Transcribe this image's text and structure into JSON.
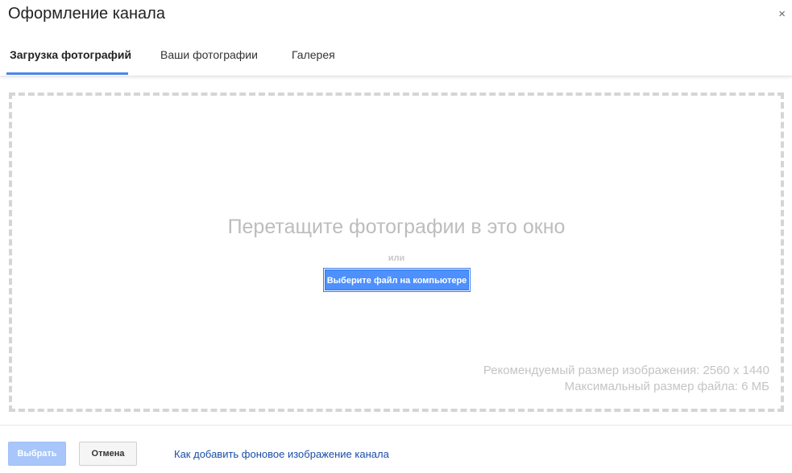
{
  "dialog": {
    "title": "Оформление канала",
    "close_label": "×"
  },
  "tabs": [
    {
      "label": "Загрузка фотографий",
      "active": true
    },
    {
      "label": "Ваши фотографии",
      "active": false
    },
    {
      "label": "Галерея",
      "active": false
    }
  ],
  "dropzone": {
    "drop_text": "Перетащите фотографии в это окно",
    "or_text": "или",
    "select_button_label": "Выберите файл на компьютере",
    "recommended_size": "Рекомендуемый размер изображения: 2560 x 1440",
    "max_file_size": "Максимальный размер файла: 6 МБ"
  },
  "footer": {
    "choose_label": "Выбрать",
    "cancel_label": "Отмена",
    "help_link": "Как добавить фоновое изображение канала"
  },
  "colors": {
    "accent": "#4d90fe",
    "tab_underline": "#4a86e8",
    "link": "#1a4da8"
  }
}
